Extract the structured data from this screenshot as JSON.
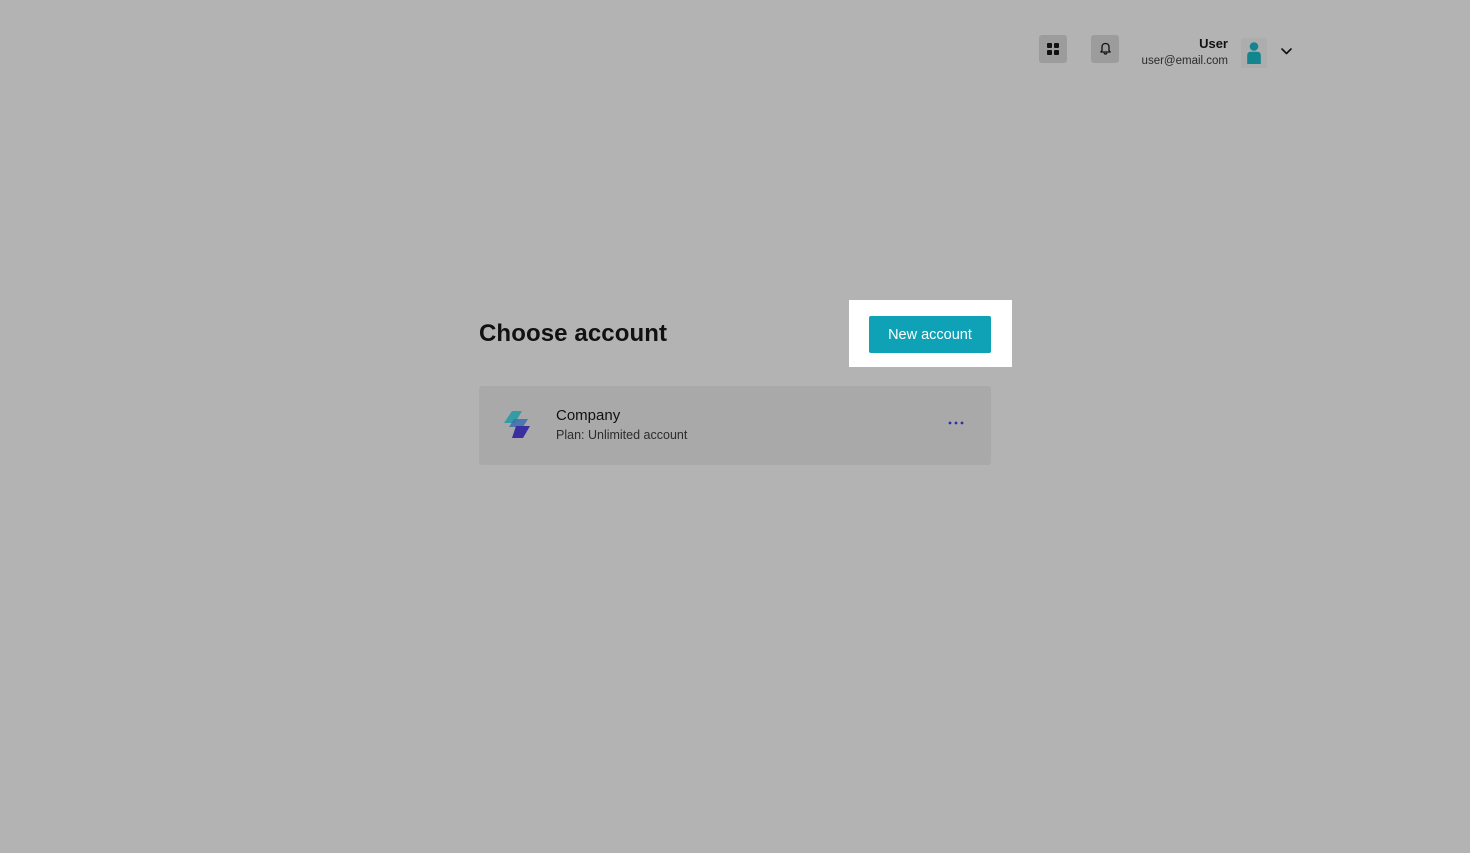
{
  "header": {
    "apps_icon": "apps-grid-icon",
    "notification_icon": "bell-icon",
    "user": {
      "name": "User",
      "email": "user@email.com",
      "avatar_icon": "person-icon",
      "menu_icon": "chevron-down-icon"
    }
  },
  "main": {
    "title": "Choose account",
    "new_account_label": "New account",
    "accounts": [
      {
        "name": "Company",
        "plan": "Plan: Unlimited account",
        "logo_icon": "company-logo-icon",
        "menu_icon": "more-options-icon"
      }
    ]
  },
  "colors": {
    "background": "#b3b3b3",
    "accent": "#0fa1b5",
    "avatar": "#12858f",
    "logo_top": "#2e9aa3",
    "logo_bottom": "#3a2fa0",
    "more_dots": "#2b2fa8"
  }
}
